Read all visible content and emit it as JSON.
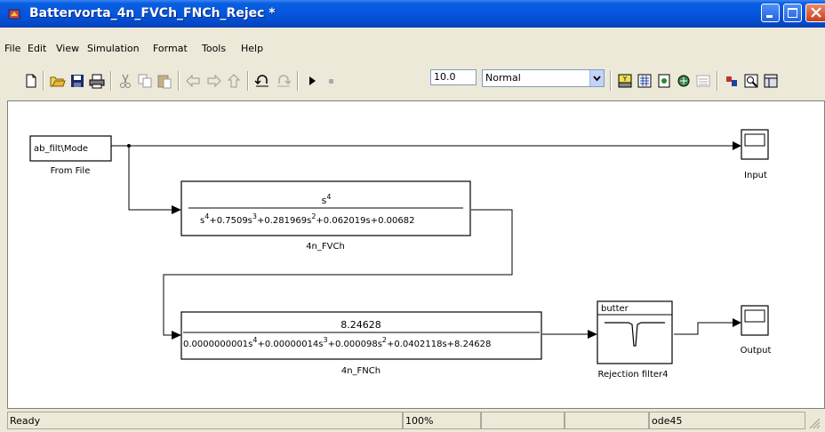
{
  "window": {
    "title": "Battervorta_4n_FVCh_FNCh_Rejec *"
  },
  "menu": {
    "items": [
      "File",
      "Edit",
      "View",
      "Simulation",
      "Format",
      "Tools",
      "Help"
    ]
  },
  "toolbar": {
    "stop_time": "10.0",
    "sim_mode": "Normal",
    "icons": [
      "new-icon",
      "open-icon",
      "save-icon",
      "print-icon",
      "cut-icon",
      "copy-icon",
      "paste-icon",
      "back-icon",
      "forward-icon",
      "up-icon",
      "undo-icon",
      "redo-icon",
      "start-icon",
      "stop-icon",
      "build-icon",
      "library-icon",
      "update-icon",
      "debug-icon",
      "explorer-icon",
      "model-icon",
      "scope-icon",
      "browser-icon"
    ]
  },
  "diagram": {
    "from_file": {
      "content": "ab_filt\\Mode",
      "label": "From File"
    },
    "tf1": {
      "numerator": "s",
      "numerator_exp": "4",
      "label": "4n_FVCh",
      "denominator": [
        {
          "t": "s"
        },
        {
          "sup": "4"
        },
        {
          "t": "+0.7509s"
        },
        {
          "sup": "3"
        },
        {
          "t": "+0.281969s"
        },
        {
          "sup": "2"
        },
        {
          "t": "+0.062019s+0.00682"
        }
      ]
    },
    "tf2": {
      "numerator": "8.24628",
      "label": "4n_FNCh",
      "denominator": [
        {
          "t": "0.0000000001s"
        },
        {
          "sup": "4"
        },
        {
          "t": "+0.00000014s"
        },
        {
          "sup": "3"
        },
        {
          "t": "+0.000098s"
        },
        {
          "sup": "2"
        },
        {
          "t": "+0.0402118s+8.24628"
        }
      ]
    },
    "rejection": {
      "title": "butter",
      "label": "Rejection filter4"
    },
    "scope_input": {
      "label": "Input"
    },
    "scope_output": {
      "label": "Output"
    }
  },
  "status": {
    "ready": "Ready",
    "zoom": "100%",
    "solver": "ode45"
  }
}
